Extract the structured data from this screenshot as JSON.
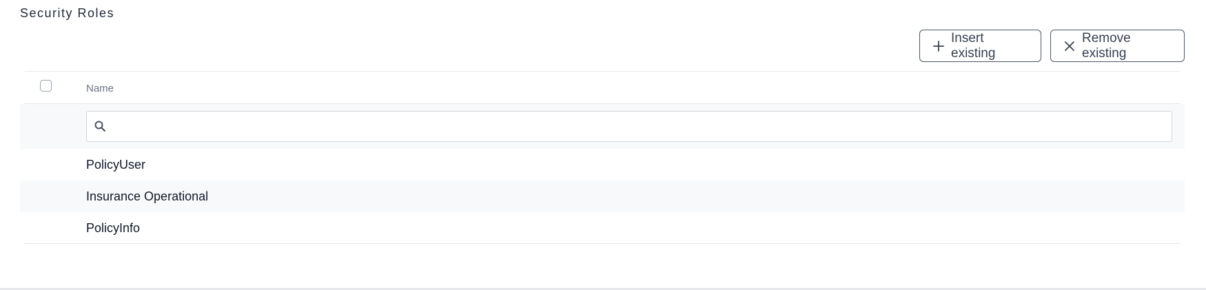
{
  "section": {
    "title": "Security Roles"
  },
  "toolbar": {
    "insert_label": "Insert existing",
    "remove_label": "Remove existing"
  },
  "table": {
    "columns": [
      "Name"
    ],
    "search": {
      "value": "",
      "placeholder": ""
    },
    "rows": [
      {
        "name": "PolicyUser"
      },
      {
        "name": "Insurance Operational"
      },
      {
        "name": "PolicyInfo"
      }
    ]
  },
  "icons": {
    "insert": "plus-icon",
    "remove": "close-icon",
    "search": "search-icon"
  }
}
